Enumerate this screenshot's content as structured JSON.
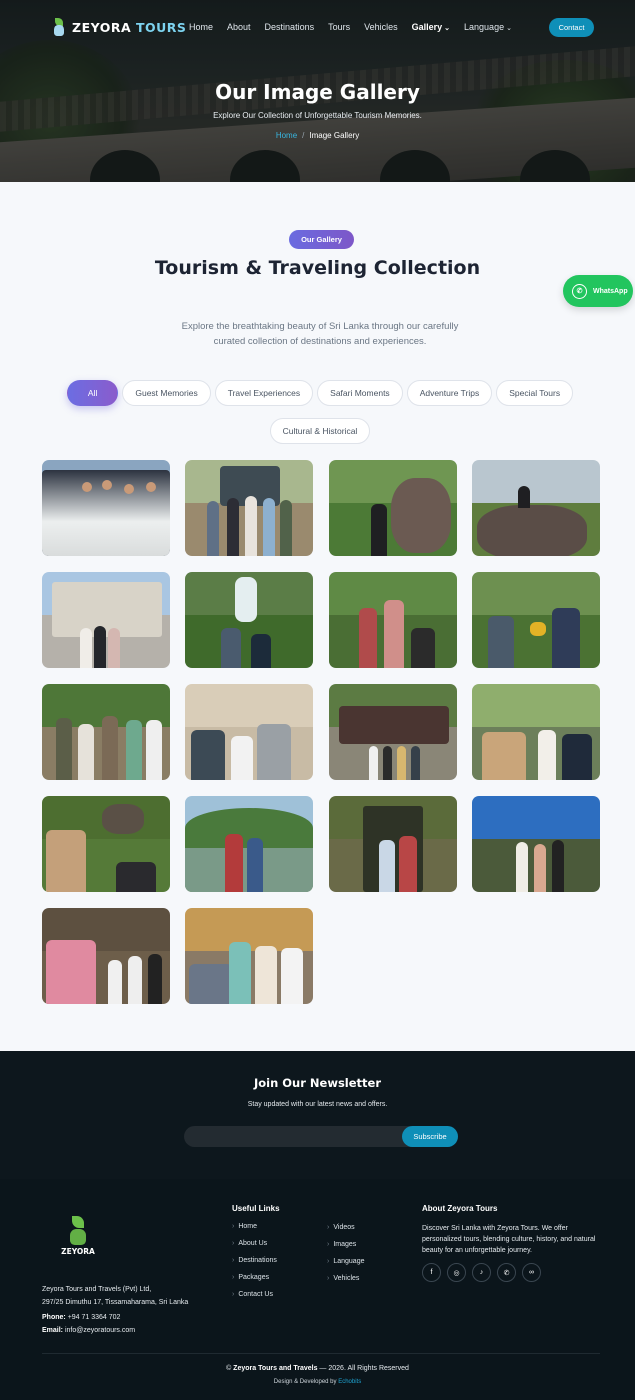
{
  "nav": {
    "brand_main": "ZEYORA",
    "brand_accent": "TOURS",
    "items": [
      "Home",
      "About",
      "Destinations",
      "Tours",
      "Vehicles",
      "Gallery",
      "Language"
    ],
    "active": "Gallery",
    "contact_label": "Contact"
  },
  "hero": {
    "title": "Our Image Gallery",
    "subtitle": "Explore Our Collection of Unforgettable Tourism Memories.",
    "breadcrumb_home": "Home",
    "breadcrumb_sep": "/",
    "breadcrumb_current": "Image Gallery"
  },
  "gallery": {
    "badge": "Our Gallery",
    "title": "Tourism & Traveling Collection",
    "description": "Explore the breathtaking beauty of Sri Lanka through our carefully curated collection of destinations and experiences.",
    "filters": [
      "All",
      "Guest Memories",
      "Travel Experiences",
      "Safari Moments",
      "Adventure Trips",
      "Special Tours",
      "Cultural & Historical"
    ],
    "active_filter": "All"
  },
  "whatsapp": {
    "label": "WhatsApp",
    "color": "#22c55e"
  },
  "newsletter": {
    "title": "Join Our Newsletter",
    "subtitle": "Stay updated with our latest news and offers.",
    "input_placeholder": "",
    "button_label": "Subscribe"
  },
  "footer": {
    "logo_text": "ZEYORA",
    "company_line1": "Zeyora Tours and Travels (Pvt) Ltd,",
    "company_line2": "297/25 Dimuthu 17, Tissamaharama, Sri Lanka",
    "phone_label": "Phone:",
    "phone_value": "+94 71 3364 702",
    "email_label": "Email:",
    "email_value": "info@zeyoratours.com",
    "useful_links_title": "Useful Links",
    "links_col1": [
      "Home",
      "About Us",
      "Destinations",
      "Packages",
      "Contact Us"
    ],
    "links_col2": [
      "Videos",
      "Images",
      "Language",
      "Vehicles"
    ],
    "about_title": "About Zeyora Tours",
    "about_text": "Discover Sri Lanka with Zeyora Tours. We offer personalized tours, blending culture, history, and natural beauty for an unforgettable journey.",
    "socials": [
      "facebook-icon",
      "instagram-icon",
      "tiktok-icon",
      "whatsapp-icon",
      "tripadvisor-icon"
    ],
    "copyright_brand": "Zeyora Tours and Travels",
    "copyright_rest": "— 2026. All Rights Reserved",
    "dev_prefix": "Design & Developed by",
    "dev_name": "Echobits"
  },
  "colors": {
    "accent": "#0f8fb8",
    "badge_gradient": "#6a6be0",
    "dark_bg": "#0b151b"
  }
}
